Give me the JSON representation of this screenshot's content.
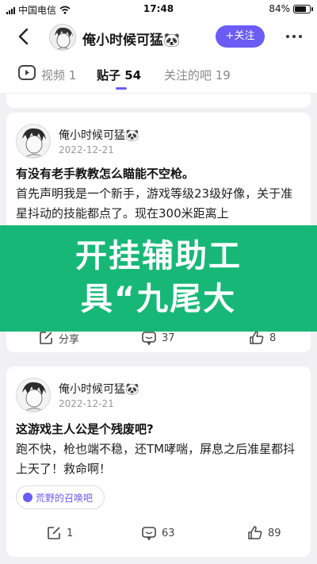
{
  "status_bar": {
    "carrier": "中国电信",
    "time": "17:48",
    "battery": "84%",
    "battery_level": 0.84
  },
  "header": {
    "user_name": "俺小时候可猛🐼",
    "follow_label": "+关注"
  },
  "tabs": [
    {
      "label": "视频 1",
      "active": false
    },
    {
      "label": "贴子 54",
      "active": true
    },
    {
      "label": "关注的吧 19",
      "active": false
    }
  ],
  "overlay": {
    "line1": "开挂辅助工",
    "line2": "具“九尾大"
  },
  "posts": [
    {
      "author": "俺小时候可猛🐼",
      "date": "2022-12-21",
      "title": "有没有老手教教怎么瞄能不空枪。",
      "body": "首先声明我是一个新手，游戏等级23级好像，关于准星抖动的技能都点了。现在300米距离上",
      "share_label": "分享",
      "comments": "37",
      "likes": "8"
    },
    {
      "author": "俺小时候可猛🐼",
      "date": "2022-12-21",
      "title": "这游戏主人公是个残废吧?",
      "body": "跑不快，枪也端不稳，还TM哮喘，屏息之后准星都抖上天了！救命啊！",
      "tag": "荒野的召唤吧",
      "shares": "1",
      "comments": "63",
      "likes": "89"
    }
  ],
  "colors": {
    "accent": "#6a5cf5",
    "overlay": "#17b877"
  }
}
